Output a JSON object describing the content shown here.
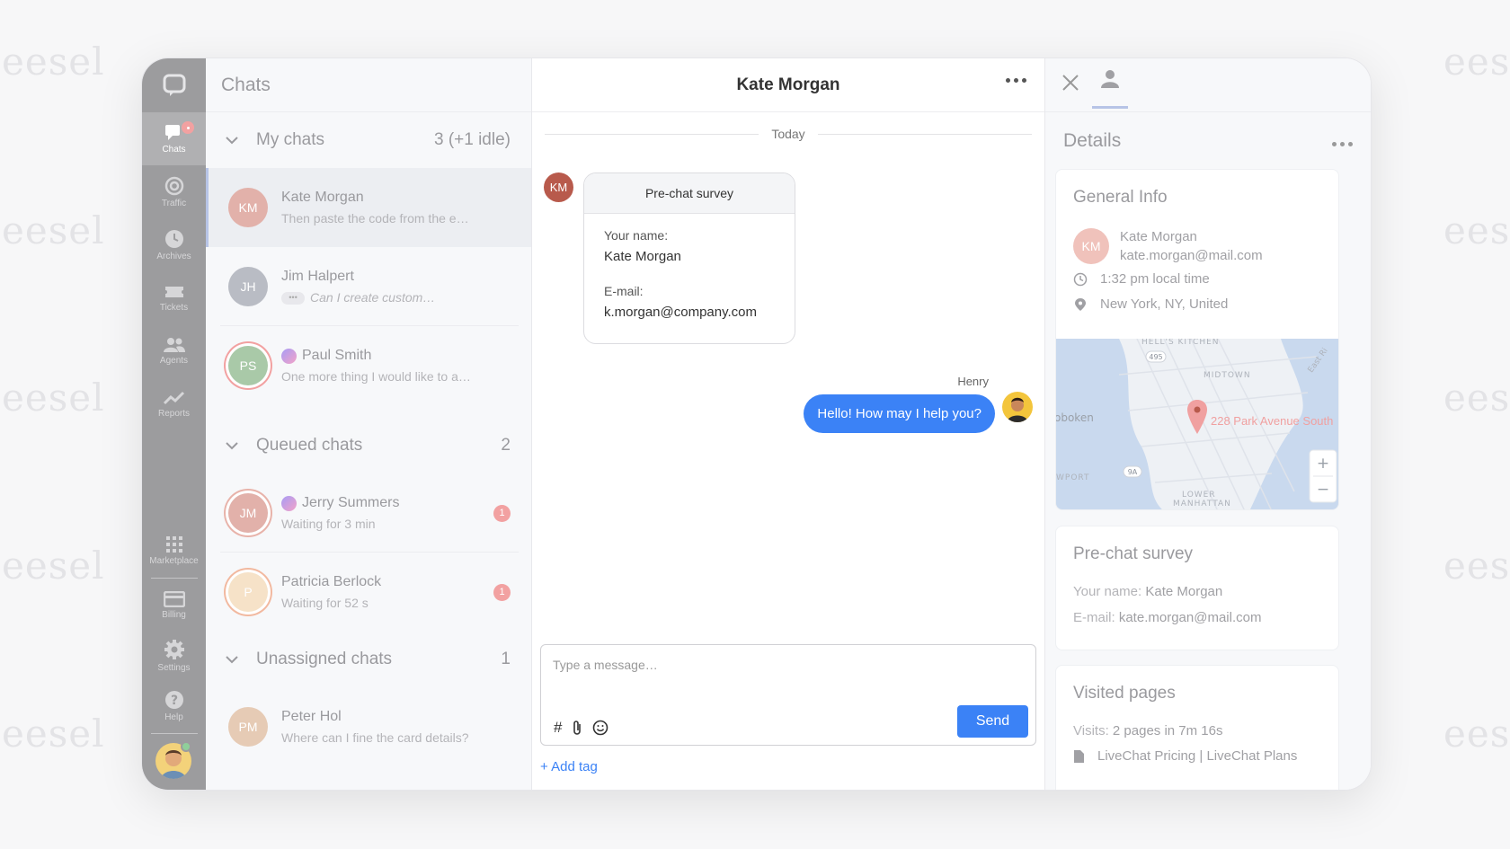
{
  "watermark": "eesel",
  "colors": {
    "accent": "#3b82f6",
    "rail": "#9c9c9e",
    "badge": "#f2a1a1"
  },
  "rail": {
    "items": [
      {
        "label": "Chats",
        "icon": "chat-icon"
      },
      {
        "label": "Traffic",
        "icon": "traffic-icon"
      },
      {
        "label": "Archives",
        "icon": "clock-icon"
      },
      {
        "label": "Tickets",
        "icon": "ticket-icon"
      },
      {
        "label": "Agents",
        "icon": "agents-icon"
      },
      {
        "label": "Reports",
        "icon": "reports-icon"
      }
    ],
    "bottom": [
      {
        "label": "Marketplace",
        "icon": "grid-icon"
      },
      {
        "label": "Billing",
        "icon": "card-icon"
      },
      {
        "label": "Settings",
        "icon": "gear-icon"
      },
      {
        "label": "Help",
        "icon": "help-icon"
      }
    ]
  },
  "chats": {
    "title": "Chats",
    "my": {
      "label": "My chats",
      "count": "3 (+1 idle)"
    },
    "queued": {
      "label": "Queued chats",
      "count": "2"
    },
    "unassigned": {
      "label": "Unassigned chats",
      "count": "1"
    },
    "my_items": [
      {
        "initials": "KM",
        "name": "Kate Morgan",
        "preview": "Then paste the code from the e…",
        "color": "#e2b1aa"
      },
      {
        "initials": "JH",
        "name": "Jim Halpert",
        "preview": "Can I create custom…",
        "color": "#b9bcc4"
      },
      {
        "initials": "PS",
        "name": "Paul Smith",
        "preview": "One more thing I would like to a…",
        "color": "#a9c9a8"
      }
    ],
    "queued_items": [
      {
        "initials": "JM",
        "name": "Jerry Summers",
        "preview": "Waiting for 3 min",
        "badge": "1",
        "color": "#e2b1aa"
      },
      {
        "initials": "P",
        "name": "Patricia Berlock",
        "preview": "Waiting for 52 s",
        "badge": "1",
        "color": "#f6e2c8"
      }
    ],
    "unassigned_items": [
      {
        "initials": "PM",
        "name": "Peter Hol",
        "preview": "Where can I fine the card details?",
        "color": "#e6cbb5"
      }
    ]
  },
  "conversation": {
    "title": "Kate Morgan",
    "day": "Today",
    "customer_initials": "KM",
    "survey": {
      "title": "Pre-chat survey",
      "name_label": "Your name:",
      "name_value": "Kate Morgan",
      "email_label": "E-mail:",
      "email_value": "k.morgan@company.com"
    },
    "agent_name": "Henry",
    "agent_message": "Hello! How may I help you?",
    "composer_placeholder": "Type a message…",
    "send_label": "Send",
    "add_tag": "+ Add tag"
  },
  "details": {
    "title": "Details",
    "general": {
      "title": "General Info",
      "initials": "KM",
      "name": "Kate Morgan",
      "email": "kate.morgan@mail.com",
      "local_time": "1:32 pm local time",
      "location": "New York, NY, United"
    },
    "map": {
      "pin_label": "228 Park Avenue South",
      "labels": [
        "HELL'S KITCHEN",
        "MIDTOWN",
        "oboken",
        "LOWER",
        "MANHATTAN",
        "WPORT",
        "495",
        "9A",
        "East Ri"
      ],
      "zoom_in": "+",
      "zoom_out": "−"
    },
    "prechat": {
      "title": "Pre-chat survey",
      "name_label": "Your name:",
      "name_value": "Kate Morgan",
      "email_label": "E-mail:",
      "email_value": "kate.morgan@mail.com"
    },
    "visited": {
      "title": "Visited pages",
      "visits_label": "Visits:",
      "visits_value": "2 pages in 7m 16s",
      "page": "LiveChat Pricing | LiveChat Plans"
    }
  }
}
